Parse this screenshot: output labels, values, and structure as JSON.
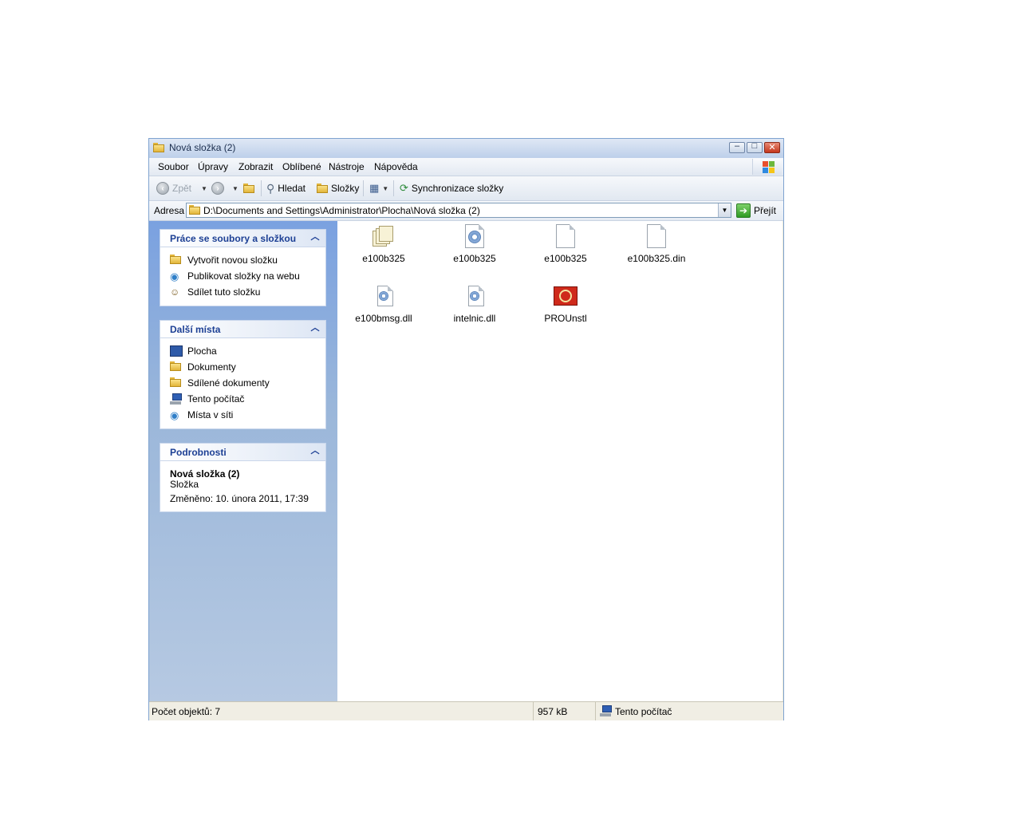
{
  "window": {
    "title": "Nová složka (2)",
    "controls": {
      "minimize": "–",
      "maximize": "□",
      "close": "✕"
    }
  },
  "menu": [
    "Soubor",
    "Úpravy",
    "Zobrazit",
    "Oblíbené",
    "Nástroje",
    "Nápověda"
  ],
  "toolbar": {
    "back_label": "Zpět",
    "search_label": "Hledat",
    "folders_label": "Složky",
    "sync_label": "Synchronizace složky"
  },
  "address": {
    "label": "Adresa",
    "value": "D:\\Documents and Settings\\Administrator\\Plocha\\Nová složka (2)",
    "go_label": "Přejít"
  },
  "taskpane": {
    "file_tasks": {
      "title": "Práce se soubory a složkou",
      "items": [
        "Vytvořit novou složku",
        "Publikovat složky na webu",
        "Sdílet tuto složku"
      ]
    },
    "other_places": {
      "title": "Další místa",
      "items": [
        "Plocha",
        "Dokumenty",
        "Sdílené dokumenty",
        "Tento počítač",
        "Místa v síti"
      ]
    },
    "details": {
      "title": "Podrobnosti",
      "name": "Nová složka (2)",
      "type": "Složka",
      "modified": "Změněno: 10. února 2011, 17:39"
    }
  },
  "files": [
    {
      "name": "e100b325",
      "icon": "setup-info-icon"
    },
    {
      "name": "e100b325",
      "icon": "config-settings-icon"
    },
    {
      "name": "e100b325",
      "icon": "blank-file-icon"
    },
    {
      "name": "e100b325.din",
      "icon": "blank-file-icon"
    },
    {
      "name": "e100bmsg.dll",
      "icon": "dll-file-icon"
    },
    {
      "name": "intelnic.dll",
      "icon": "dll-file-icon"
    },
    {
      "name": "PROUnstl",
      "icon": "uninstall-app-icon"
    }
  ],
  "status": {
    "count": "Počet objektů: 7",
    "size": "957 kB",
    "location": "Tento počítač"
  }
}
